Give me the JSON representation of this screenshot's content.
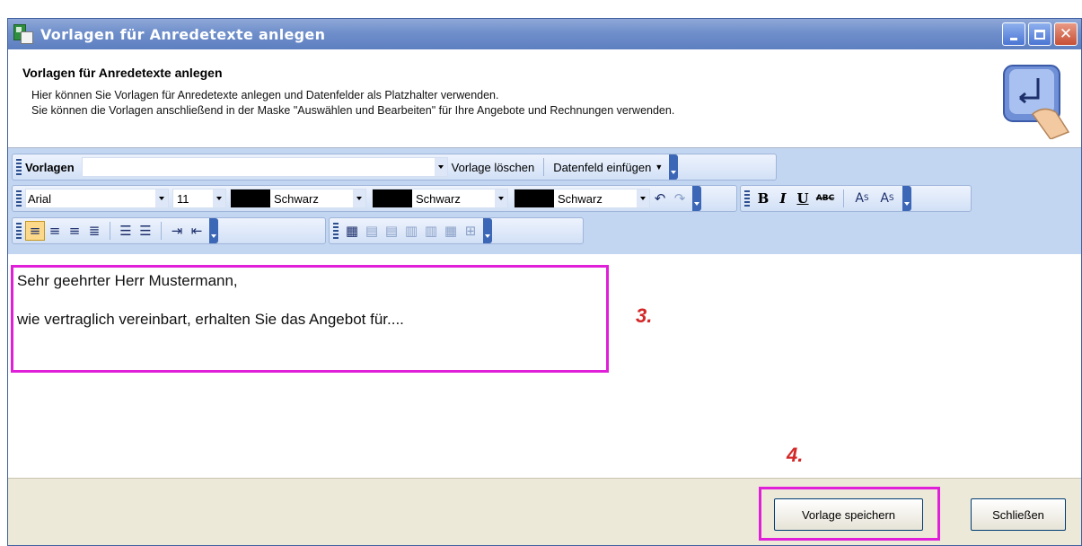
{
  "window": {
    "title": "Vorlagen für Anredetexte anlegen"
  },
  "header": {
    "title": "Vorlagen für Anredetexte anlegen",
    "line1": "Hier können Sie Vorlagen für Anredetexte anlegen und Datenfelder als Platzhalter verwenden.",
    "line2": "Sie können die Vorlagen anschließend in der Maske \"Auswählen und Bearbeiten\" für Ihre Angebote und Rechnungen verwenden."
  },
  "toolbar": {
    "vorlagen_label": "Vorlagen",
    "vorlagen_value": "",
    "delete_label": "Vorlage löschen",
    "insert_field_label": "Datenfeld einfügen",
    "font_name": "Arial",
    "font_size": "11",
    "color1": "Schwarz",
    "color2": "Schwarz",
    "color3": "Schwarz",
    "swatch_color": "#000000"
  },
  "editor": {
    "line1": "Sehr geehrter Herr Mustermann,",
    "line2": "wie vertraglich vereinbart, erhalten Sie das Angebot für...."
  },
  "annotations": {
    "step3": "3.",
    "step4": "4.",
    "highlight_color": "#e020d8",
    "number_color": "#d42828"
  },
  "footer": {
    "save_label": "Vorlage speichern",
    "close_label": "Schließen"
  }
}
